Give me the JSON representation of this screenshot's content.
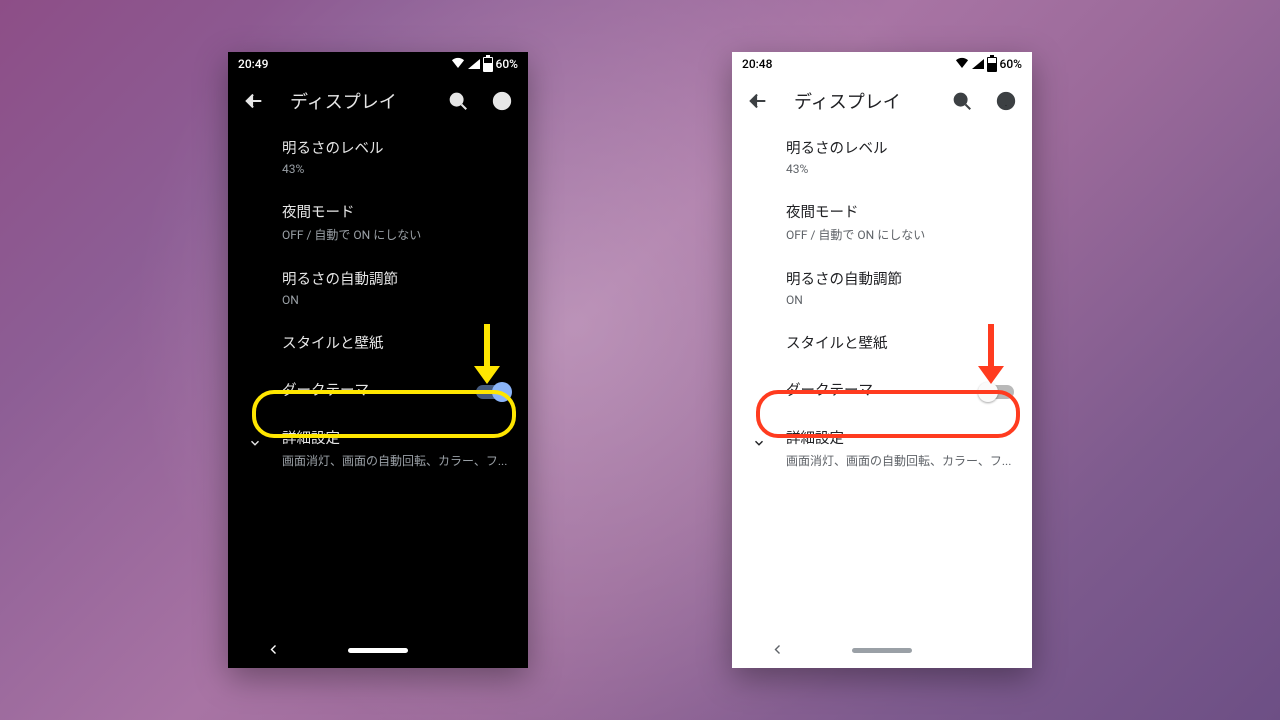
{
  "annotation_colors": {
    "dark": "#ffe600",
    "light": "#ff3b1f"
  },
  "dark": {
    "status": {
      "time": "20:49",
      "battery": "60%"
    },
    "appbar": {
      "title": "ディスプレイ"
    },
    "items": {
      "brightness": {
        "title": "明るさのレベル",
        "sub": "43%"
      },
      "night": {
        "title": "夜間モード",
        "sub": "OFF / 自動で ON にしない"
      },
      "adaptive": {
        "title": "明るさの自動調節",
        "sub": "ON"
      },
      "style": {
        "title": "スタイルと壁紙"
      },
      "darktheme": {
        "title": "ダークテーマ",
        "on": true
      },
      "advanced": {
        "title": "詳細設定",
        "sub": "画面消灯、画面の自動回転、カラー、フ..."
      }
    }
  },
  "light": {
    "status": {
      "time": "20:48",
      "battery": "60%"
    },
    "appbar": {
      "title": "ディスプレイ"
    },
    "items": {
      "brightness": {
        "title": "明るさのレベル",
        "sub": "43%"
      },
      "night": {
        "title": "夜間モード",
        "sub": "OFF / 自動で ON にしない"
      },
      "adaptive": {
        "title": "明るさの自動調節",
        "sub": "ON"
      },
      "style": {
        "title": "スタイルと壁紙"
      },
      "darktheme": {
        "title": "ダークテーマ",
        "on": false
      },
      "advanced": {
        "title": "詳細設定",
        "sub": "画面消灯、画面の自動回転、カラー、フ..."
      }
    }
  }
}
